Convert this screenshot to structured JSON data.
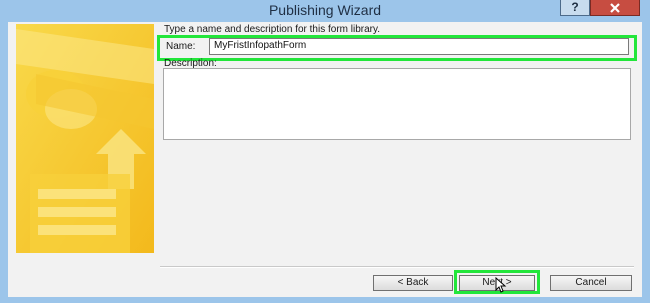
{
  "window": {
    "title": "Publishing Wizard",
    "help_label": "?",
    "close_icon": "close-icon"
  },
  "form": {
    "instruction": "Type a name and description for this form library.",
    "name_label": "Name:",
    "name_value": "MyFristInfopathForm",
    "description_label": "Description:",
    "description_value": ""
  },
  "buttons": {
    "back": "< Back",
    "next": "Next >",
    "cancel": "Cancel"
  },
  "colors": {
    "highlight": "#22e63a",
    "title_bar": "#9cc5ea",
    "close_button": "#c74d41",
    "banner": "#f7c52f"
  }
}
